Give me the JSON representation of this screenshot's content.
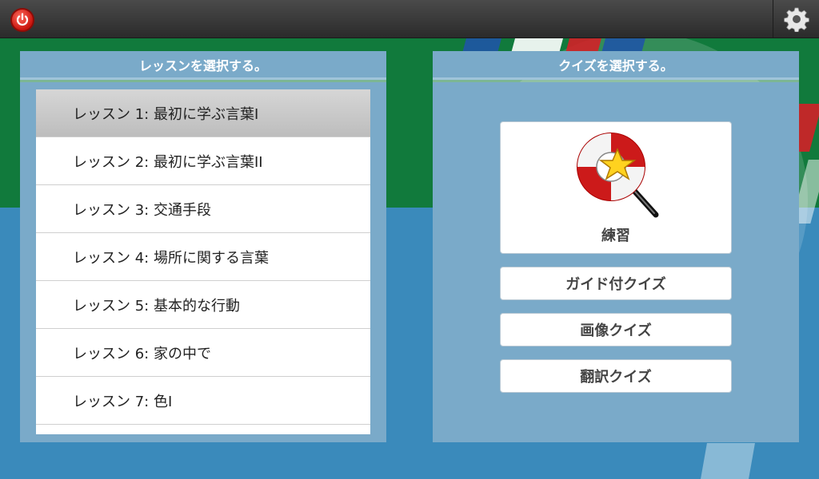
{
  "left_panel": {
    "title": "レッスンを選択する。",
    "lessons": [
      {
        "label": "レッスン 1: 最初に学ぶ言葉I"
      },
      {
        "label": "レッスン 2: 最初に学ぶ言葉II"
      },
      {
        "label": "レッスン 3: 交通手段"
      },
      {
        "label": "レッスン 4: 場所に関する言葉"
      },
      {
        "label": "レッスン 5: 基本的な行動"
      },
      {
        "label": "レッスン 6: 家の中で"
      },
      {
        "label": "レッスン 7: 色I"
      }
    ]
  },
  "right_panel": {
    "title": "クイズを選択する。",
    "practice_label": "練習",
    "guided_quiz_label": "ガイド付クイズ",
    "image_quiz_label": "画像クイズ",
    "translation_quiz_label": "翻訳クイズ"
  },
  "icons": {
    "power": "power-icon",
    "settings": "gear-icon",
    "practice": "lifebuoy-wand-icon"
  },
  "colors": {
    "topbar": "#333333",
    "panel_header": "#7aaac9",
    "selected_item": "#c8c8c8",
    "power_red": "#d0190f",
    "bg_green": "#117a3c",
    "bg_blue": "#3a8abb"
  }
}
